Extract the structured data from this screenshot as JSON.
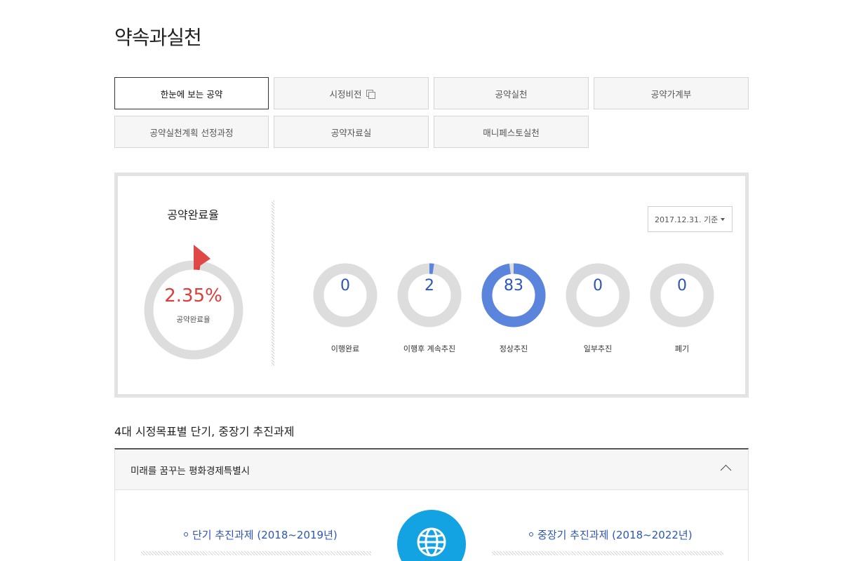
{
  "page": {
    "title": "약속과실천"
  },
  "tabs": [
    {
      "label": "한눈에 보는 공약",
      "active": true,
      "external": false
    },
    {
      "label": "시정비전",
      "active": false,
      "external": true
    },
    {
      "label": "공약실천",
      "active": false,
      "external": false
    },
    {
      "label": "공약가계부",
      "active": false,
      "external": false
    },
    {
      "label": "공약실천계획 선정과정",
      "active": false,
      "external": false
    },
    {
      "label": "공약자료실",
      "active": false,
      "external": false
    },
    {
      "label": "매니페스토실천",
      "active": false,
      "external": false
    }
  ],
  "completion": {
    "title": "공약완료율",
    "value": "2.35%",
    "value_fraction": 0.0235,
    "sublabel": "공약완료율"
  },
  "date_select": {
    "value": "2017.12.31. 기준"
  },
  "statuses": [
    {
      "count": "0",
      "label": "이행완료",
      "fraction": 0
    },
    {
      "count": "2",
      "label": "이행후 계속추진",
      "fraction": 0.0235
    },
    {
      "count": "83",
      "label": "정상추진",
      "fraction": 0.9765
    },
    {
      "count": "0",
      "label": "일부추진",
      "fraction": 0
    },
    {
      "count": "0",
      "label": "폐기",
      "fraction": 0
    }
  ],
  "section": {
    "title": "4대 시정목표별 단기, 중장기 추진과제"
  },
  "accordion": {
    "title": "미래를 꿈꾸는 평화경제특별시",
    "short_term": "단기 추진과제 (2018~2019년)",
    "long_term": "중장기 추진과제 (2018~2022년)"
  },
  "colors": {
    "accent": "#2c56b8",
    "red": "#e03c3c",
    "ring": "#dddddd",
    "progress": "#5b84dc",
    "globe": "#14a3e2"
  },
  "icons": {
    "globe": "globe-icon",
    "chevron": "chevron-up-icon",
    "external": "external-window-icon",
    "caret": "caret-down-icon"
  }
}
